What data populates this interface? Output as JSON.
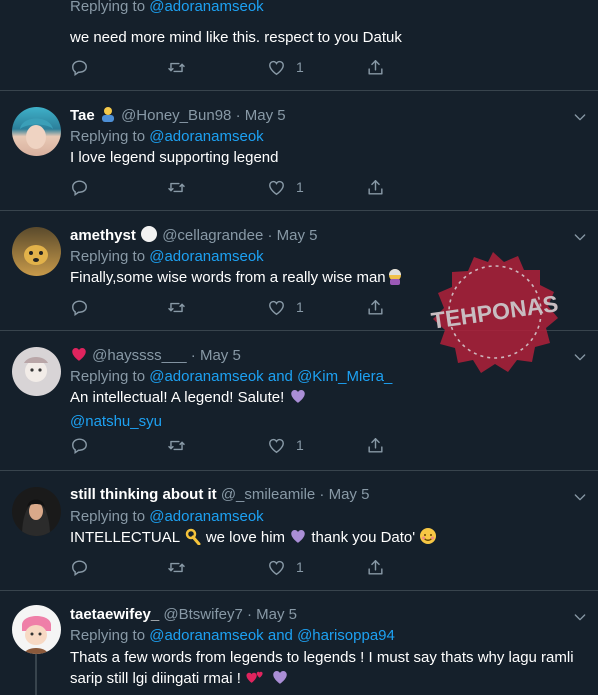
{
  "tweets": [
    {
      "name": "",
      "handle": "",
      "date": "",
      "replying_prefix": "Replying to",
      "replying_to": "@adoranamseok",
      "replying_and": "",
      "replying_to2": "",
      "text": "we need more mind like this. respect to you Datuk",
      "likes": "1"
    },
    {
      "name": "Tae",
      "handle": "@Honey_Bun98",
      "date": "· May 5",
      "replying_prefix": "Replying to",
      "replying_to": "@adoranamseok",
      "text": "I love legend supporting legend",
      "likes": "1"
    },
    {
      "name": "amethyst",
      "handle": "@cellagrandee",
      "date": "· May 5",
      "replying_prefix": "Replying to",
      "replying_to": "@adoranamseok",
      "text": "Finally,some wise words from a really wise man",
      "likes": "1"
    },
    {
      "name": "",
      "handle": "@hayssss___",
      "date": "· May 5",
      "replying_prefix": "Replying to",
      "replying_to": "@adoranamseok",
      "replying_and": "and",
      "replying_to2": "@Kim_Miera_",
      "text": "An intellectual! A legend! Salute!",
      "mention": "@natshu_syu",
      "likes": "1"
    },
    {
      "name": "still thinking about it",
      "handle": "@_smileamile",
      "date": "· May 5",
      "replying_prefix": "Replying to",
      "replying_to": "@adoranamseok",
      "text_a": "INTELLECTUAL",
      "text_b": "we love him",
      "text_c": "thank you Dato'",
      "likes": "1"
    },
    {
      "name": "taetaewifey_",
      "handle": "@Btswifey7",
      "date": "· May 5",
      "replying_prefix": "Replying to",
      "replying_to": "@adoranamseok",
      "replying_and": "and",
      "replying_to2": "@harisoppa94",
      "text_line1": "Thats a few words from legends to legends ! I must say thats why lagu ramli",
      "text_line2": "sarip still lgi diingati rmai !"
    }
  ],
  "watermark": {
    "text": "TEHPONAS"
  },
  "colors": {
    "background": "#15202b",
    "link": "#1da1f2",
    "muted": "#8899a6",
    "divider": "#38444d"
  }
}
